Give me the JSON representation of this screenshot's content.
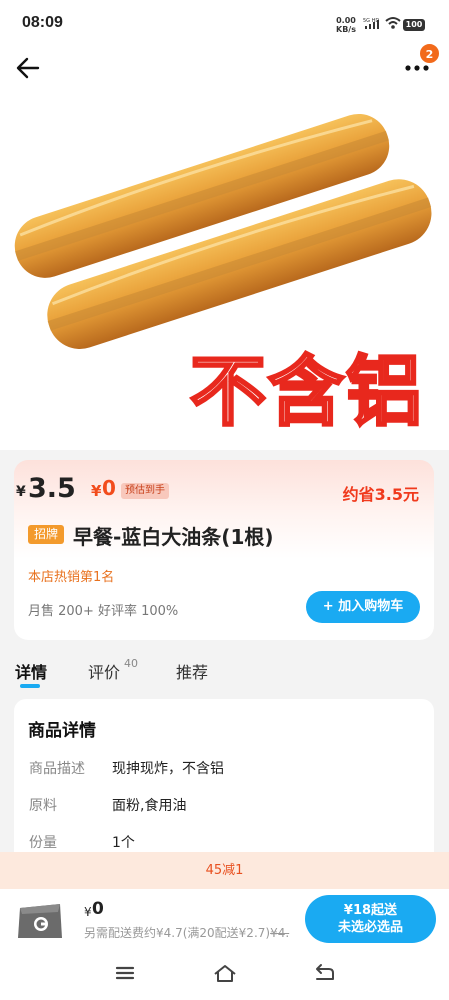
{
  "status_bar": {
    "time": "08:09",
    "net_speed": "0.00",
    "net_unit": "KB/s",
    "network": "5G HD",
    "battery": "100"
  },
  "header": {
    "badge_count": "2"
  },
  "hero": {
    "caption": "不含铝"
  },
  "product": {
    "currency": "¥",
    "price": "3.5",
    "delivery_price": "0",
    "delivery_tag": "预估到手",
    "savings": "约省3.5元",
    "tag": "招牌",
    "title": "早餐-蓝白大油条(1根)",
    "rank": "本店热销第1名",
    "sales": "月售 200+ 好评率 100%",
    "add_to_cart": "+ 加入购物车"
  },
  "tabs": [
    {
      "label": "详情",
      "active": true
    },
    {
      "label": "评价",
      "count": "40"
    },
    {
      "label": "推荐"
    }
  ],
  "details": {
    "title": "商品详情",
    "rows": [
      {
        "label": "商品描述",
        "value": "现抻现炸，不含铝"
      },
      {
        "label": "原料",
        "value": "面粉,食用油"
      },
      {
        "label": "份量",
        "value": "1个"
      }
    ]
  },
  "promo": {
    "text": "45减1"
  },
  "bottom_bar": {
    "currency": "¥",
    "total": "0",
    "fee_text": "另需配送费约¥4.7(满20配送¥2.7)",
    "fee_strike": "¥4.",
    "checkout_line1": "¥18起送",
    "checkout_line2": "未选必选品"
  },
  "colors": {
    "accent": "#1aaaf2",
    "price_red": "#f03a1d",
    "tag_orange": "#f39a2c"
  }
}
